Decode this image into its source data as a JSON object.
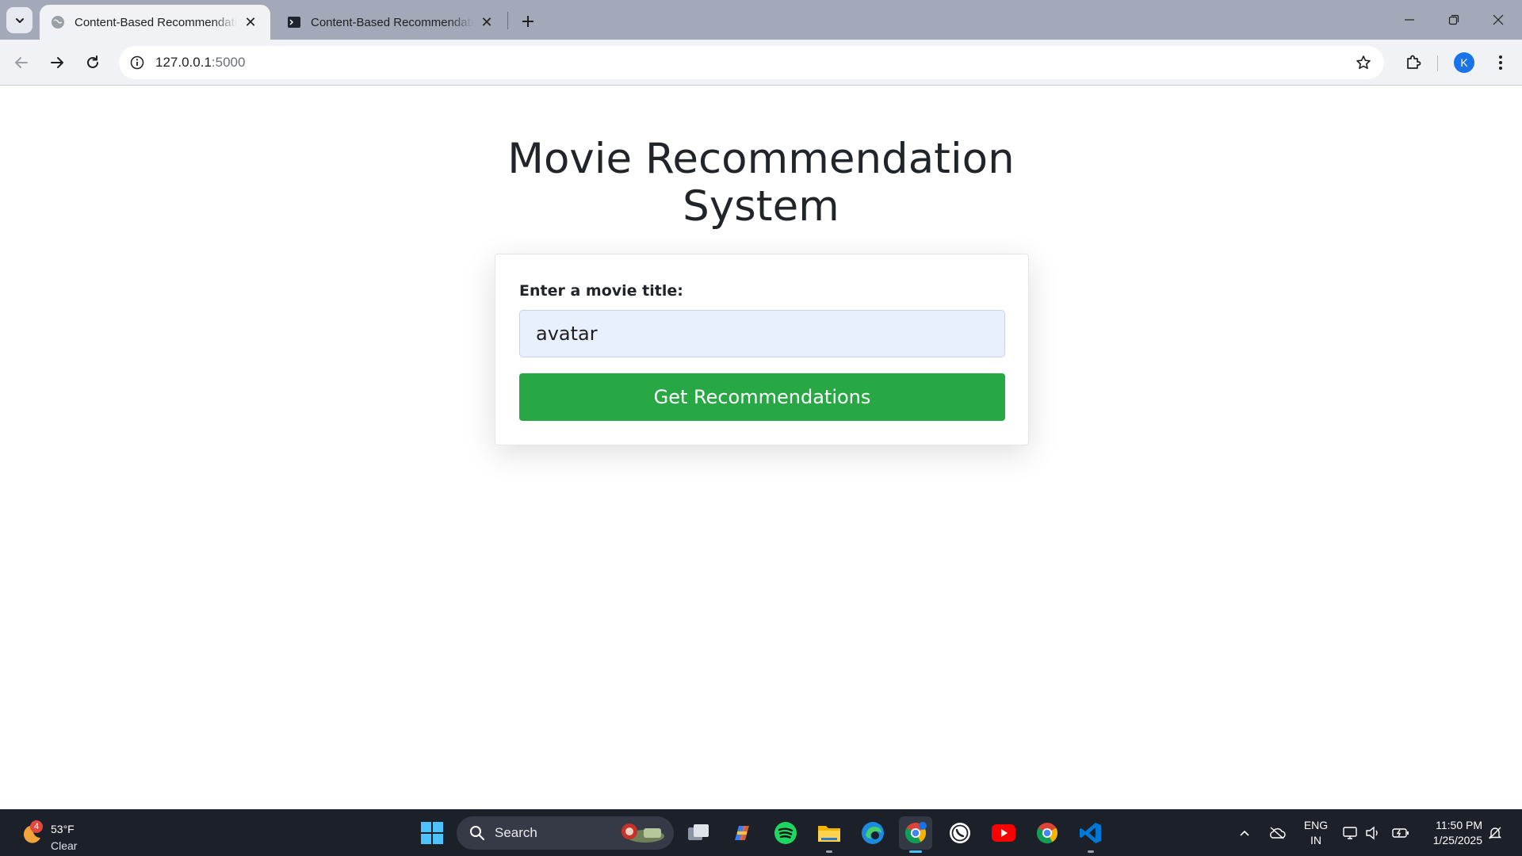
{
  "browser": {
    "tabs": [
      {
        "title": "Content-Based Recommendation System",
        "favicon": "globe-icon",
        "active": true
      },
      {
        "title": "Content-Based Recommendation System",
        "favicon": "terminal-icon",
        "active": false
      }
    ],
    "address": {
      "host": "127.0.0.1",
      "port": ":5000"
    },
    "profile_initial": "K"
  },
  "page": {
    "heading": "Movie Recommendation System",
    "form": {
      "label": "Enter a movie title:",
      "input_value": "avatar",
      "button_label": "Get Recommendations"
    }
  },
  "taskbar": {
    "weather": {
      "temp": "53°F",
      "condition": "Clear",
      "badge": "4"
    },
    "search_label": "Search",
    "language": {
      "line1": "ENG",
      "line2": "IN"
    },
    "clock": {
      "time": "11:50 PM",
      "date": "1/25/2025"
    },
    "apps": [
      "windows-start-icon",
      "task-view-icon",
      "copilot-icon",
      "spotify-icon",
      "file-explorer-icon",
      "edge-icon",
      "chrome-profile-icon",
      "whatsapp-icon",
      "youtube-icon",
      "chrome-icon",
      "vscode-icon"
    ]
  },
  "colors": {
    "accent_button": "#28a745",
    "input_bg": "#e8f0fe",
    "tabstrip": "#a3a9b8",
    "taskbar": "#1c2029"
  }
}
